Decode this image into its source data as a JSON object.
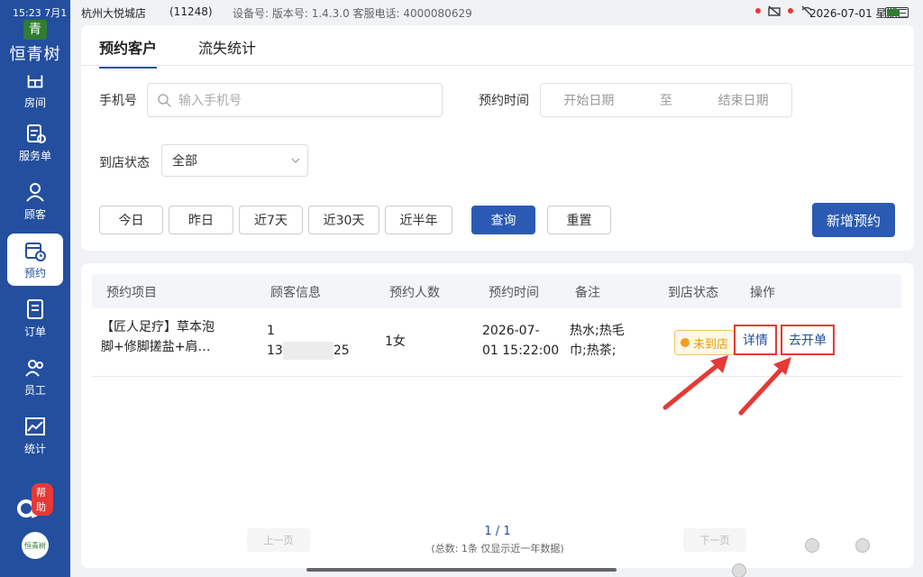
{
  "status": {
    "time": "15:23",
    "date_left": "7月1",
    "store": "杭州大悦城店",
    "store_id": "(11248)",
    "device": "设备号: 版本号: 1.4.3.0 客服电话: 4000080629",
    "date": "2026-07-01 星期三"
  },
  "sidebar": {
    "logo_char": "青",
    "logo_text": "恒青树",
    "items": [
      {
        "label": "房间",
        "icon": "room-icon"
      },
      {
        "label": "服务单",
        "icon": "service-icon"
      },
      {
        "label": "顾客",
        "icon": "customer-icon"
      },
      {
        "label": "预约",
        "icon": "calendar-icon"
      },
      {
        "label": "订单",
        "icon": "order-icon"
      },
      {
        "label": "员工",
        "icon": "staff-icon"
      },
      {
        "label": "统计",
        "icon": "stats-icon"
      }
    ],
    "help_badge": "帮助",
    "bottom_logo": "恒青树"
  },
  "tabs": [
    "预约客户",
    "流失统计"
  ],
  "filters": {
    "phone_label": "手机号",
    "phone_placeholder": "输入手机号",
    "time_label": "预约时间",
    "start_placeholder": "开始日期",
    "to": "至",
    "end_placeholder": "结束日期",
    "status_label": "到店状态",
    "status_value": "全部"
  },
  "quick_buttons": [
    "今日",
    "昨日",
    "近7天",
    "近30天",
    "近半年"
  ],
  "actions": {
    "query": "查询",
    "reset": "重置",
    "add": "新增预约"
  },
  "table": {
    "headers": [
      "预约项目",
      "顾客信息",
      "预约人数",
      "预约时间",
      "备注",
      "到店状态",
      "操作"
    ],
    "row": {
      "project_line1": "【匠人足疗】草本泡",
      "project_line2": "脚+修脚搓盐+肩…",
      "customer_line1": "1",
      "customer_line2": "13",
      "customer_tail": "25",
      "count": "1女",
      "time_line1": "2026-07-",
      "time_line2": "01 15:22:00",
      "note_line1": "热水;热毛",
      "note_line2": "巾;热茶;",
      "status": "未到店",
      "op_detail": "详情",
      "op_open": "去开单"
    }
  },
  "pager": {
    "prev": "上一页",
    "next": "下一页",
    "page": "1 / 1",
    "summary": "(总数: 1条 仅显示近一年数据)"
  }
}
